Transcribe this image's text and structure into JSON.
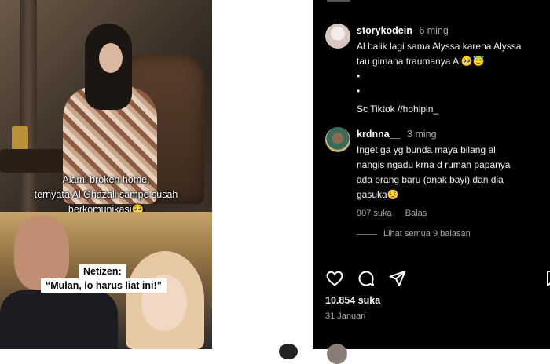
{
  "video": {
    "caption_line1": "Alami broken home,",
    "caption_line2": "ternyata Al Ghazali sampe susah",
    "caption_line3": "berkomunikasi🥺",
    "tag_netizen": "Netizen:",
    "tag_quote": "“Mulan, lo harus liat ini!”"
  },
  "comments": [
    {
      "username": "storykodein",
      "time": "6 ming",
      "lines": [
        "Al balik lagi sama Alyssa karena Alyssa",
        "tau gimana traumanya Al🥺😇",
        "•",
        "•",
        "Sc Tiktok //hohipin_"
      ]
    },
    {
      "username": "krdnna__",
      "time": "3 ming",
      "lines": [
        "Inget ga yg bunda maya bilang al",
        "nangis ngadu krna d rumah papanya",
        "ada orang baru (anak bayi) dan dia",
        "gasuka😣"
      ],
      "likes": "907 suka",
      "reply": "Balas"
    }
  ],
  "view_replies": "Lihat semua 9 balasan",
  "post": {
    "likes": "10.854 suka",
    "date": "31 Januari"
  },
  "icons": [
    "heart-icon",
    "comment-icon",
    "share-icon",
    "bookmark-icon"
  ]
}
